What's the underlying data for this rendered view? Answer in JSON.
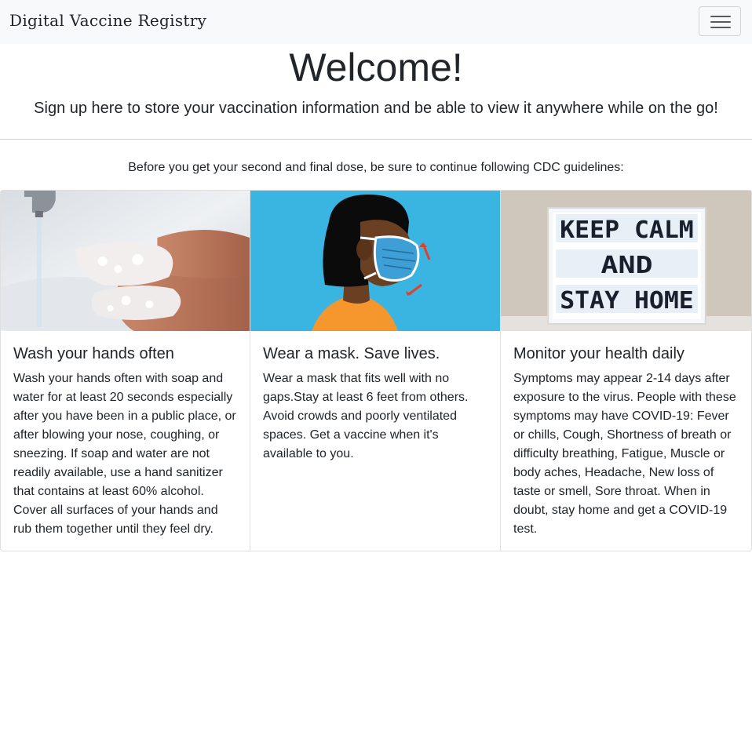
{
  "navbar": {
    "brand": "Digital Vaccine Registry",
    "toggler_icon": "hamburger-menu-icon"
  },
  "hero": {
    "title": "Welcome!",
    "subtitle": "Sign up here to store your vaccination information and be able to view it anywhere while on the go!"
  },
  "guidelines": {
    "intro": "Before you get your second and final dose, be sure to continue following CDC guidelines:",
    "cards": [
      {
        "image": "hand-washing-photo",
        "title": "Wash your hands often",
        "text": "Wash your hands often with soap and water for at least 20 seconds especially after you have been in a public place, or after blowing your nose, coughing, or sneezing. If soap and water are not readily available, use a hand sanitizer that contains at least 60% alcohol. Cover all surfaces of your hands and rub them together until they feel dry."
      },
      {
        "image": "face-mask-illustration",
        "title": "Wear a mask. Save lives.",
        "text": "Wear a mask that fits well with no gaps.Stay at least 6 feet from others. Avoid crowds and poorly ventilated spaces. Get a vaccine when it's available to you."
      },
      {
        "image": "lightbox-sign-photo",
        "sign_lines": [
          "KEEP CALM",
          "AND",
          "STAY HOME"
        ],
        "title": "Monitor your health daily",
        "text": "Symptoms may appear 2-14 days after exposure to the virus. People with these symptoms may have COVID-19: Fever or chills, Cough, Shortness of breath or difficulty breathing, Fatigue, Muscle or body aches, Headache, New loss of taste or smell, Sore throat. When in doubt, stay home and get a COVID-19 test."
      }
    ]
  },
  "colors": {
    "navbar_bg": "#f8f9fa",
    "mask_bg": "#3ab4e1",
    "shirt": "#f5972d",
    "mask": "#3d9fd6"
  }
}
